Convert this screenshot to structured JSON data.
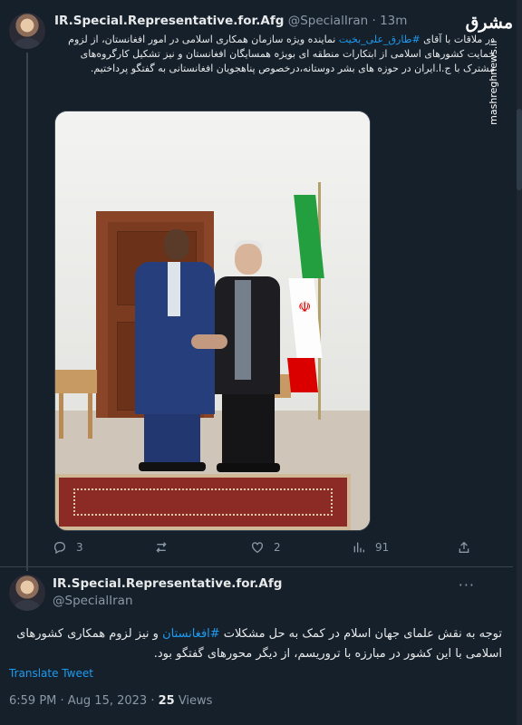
{
  "tweet1": {
    "display_name": "IR.Special.Representative.for.Afg",
    "handle": "@SpecialIran",
    "dot": "·",
    "time": "13m",
    "text_before": "در ملاقات با آقای ",
    "hashtag": "#طارق_علی_بخیت",
    "text_after": " نماینده ویژه سازمان همکاری اسلامی در امور افغانستان، از لزوم حمایت کشورهای اسلامی از ابتکارات منطقه ای بویژه همسایگان افغانستان و نیز تشکیل کارگروه‌های مشترک با ج.ا.ایران در حوزه های بشر دوستانه،درخصوص پناهجویان افغانستانی به  گفتگو پرداختیم.",
    "actions": {
      "reply_count": "3",
      "retweet_count": "",
      "like_count": "2",
      "views_count": "91"
    }
  },
  "tweet2": {
    "display_name": "IR.Special.Representative.for.Afg",
    "handle": "@SpecialIran",
    "text_before": "توجه به نقش علمای جهان اسلام در کمک به حل مشکلات ",
    "hashtag": "#افغانستان",
    "text_after": " و نیز لزوم همکاری کشورهای اسلامی با این کشور در مبارزه با تروریسم، از دیگر محورهای گفتگو بود.",
    "translate_label": "Translate Tweet",
    "time": "6:59 PM · Aug 15, 2023 · ",
    "views_count": "25",
    "views_label": " Views",
    "more": "···"
  },
  "watermark": {
    "logo": "مشرق",
    "site": "mashreghnews.ir"
  },
  "icons": {
    "reply": "reply-icon",
    "retweet": "retweet-icon",
    "like": "heart-icon",
    "views": "views-icon",
    "share": "share-icon"
  },
  "colors": {
    "background": "#15202b",
    "link": "#1d9bf0",
    "muted": "#8b98a5"
  }
}
